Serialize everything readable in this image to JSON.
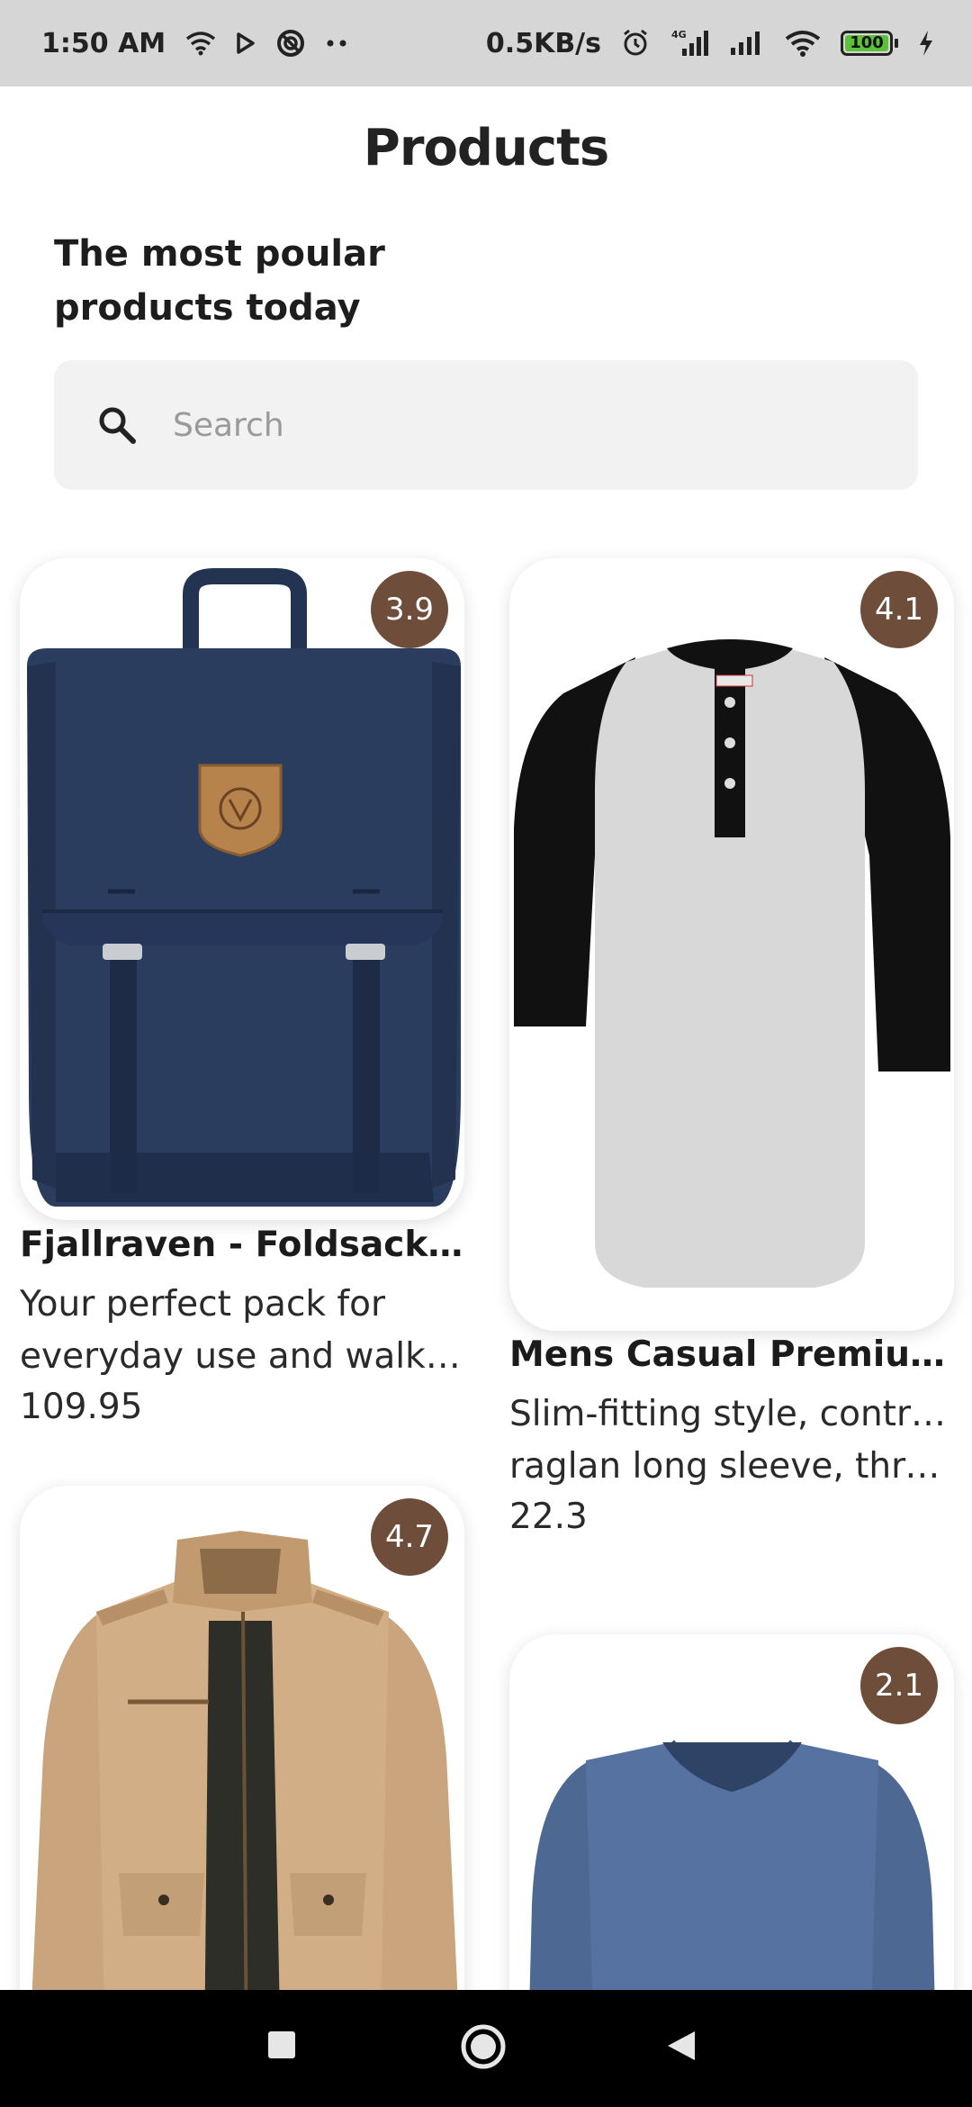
{
  "status_bar": {
    "time": "1:50 AM",
    "network_speed": "0.5KB/s",
    "battery": "100",
    "icons": [
      "wifi-icon",
      "play-store-icon",
      "sync-icon",
      "more-dots-icon",
      "alarm-icon",
      "signal-4g-icon",
      "signal-icon",
      "wifi-icon",
      "battery-icon",
      "charging-icon"
    ]
  },
  "header": {
    "title": "Products",
    "subtitle_line1": "The most poular",
    "subtitle_line2": "products today"
  },
  "search": {
    "placeholder": "Search",
    "icon": "search-icon"
  },
  "products": [
    {
      "title": "Fjallraven - Foldsack No....",
      "desc_line1": "Your perfect pack for",
      "desc_line2": "everyday use and walks ...",
      "price": "109.95",
      "rating": "3.9",
      "image": "backpack"
    },
    {
      "title": "Mens Casual Premium S...",
      "desc_line1": "Slim-fitting style, contrast",
      "desc_line2": "raglan long sleeve, thre...",
      "price": "22.3",
      "rating": "4.1",
      "image": "henley-shirt"
    },
    {
      "title": "",
      "rating": "4.7",
      "image": "jacket"
    },
    {
      "title": "",
      "rating": "2.1",
      "image": "long-sleeve-shirt"
    }
  ],
  "colors": {
    "rating_badge": "#6e4e3a",
    "search_bg": "#f2f2f2",
    "status_bar_bg": "#d6d6d6",
    "nav_bar_bg": "#000000"
  },
  "nav_bar": {
    "icons": [
      "recent-apps-icon",
      "home-icon",
      "back-icon"
    ]
  }
}
